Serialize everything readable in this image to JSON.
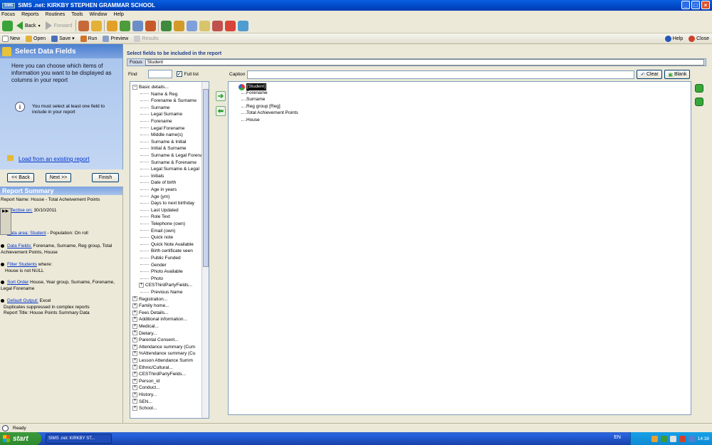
{
  "window": {
    "title": "SIMS .net: KIRKBY STEPHEN GRAMMAR SCHOOL",
    "logo": "SIMS"
  },
  "menu": [
    "Focus",
    "Reports",
    "Routines",
    "Tools",
    "Window",
    "Help"
  ],
  "nav": {
    "back": "Back",
    "forward": "Forward"
  },
  "toolbar2": {
    "new": "New",
    "open": "Open",
    "save": "Save",
    "run": "Run",
    "preview": "Preview",
    "results": "Results",
    "help": "Help",
    "close": "Close"
  },
  "left": {
    "title": "Select Data Fields",
    "intro": "Here you can choose which items of information you want to be displayed as columns in your report",
    "note": "You must select at least one field to include in your report",
    "load": "Load from an existing report",
    "back": "<< Back",
    "next": "Next >>",
    "finish": "Finish"
  },
  "summary": {
    "title": "Report Summary",
    "name": "Report Name: House - Total Acheivement Points",
    "effective_label": "Effective on:",
    "effective_value": "30/10/2011",
    "data_area_label": "Data area: Student",
    "data_area_rest": " - Population: On roll",
    "fields_label": "Data Fields:",
    "fields_value": "Forename, Surname, Reg group, Total Achievement Points, House",
    "filter_label": "Filter Students",
    "filter_rest": " where:",
    "filter_value": "House is not NULL",
    "sort_label": "Sort Order",
    "sort_value": "House, Year group, Surname, Forename, Legal Forename",
    "output_label": "Default Output:",
    "output_value": "Excel",
    "dup": "Duplicates suppressed in complex reports",
    "report_title": "Report Title: House Points Summary Data"
  },
  "main": {
    "header": "Select fields to be included in the report",
    "focus_label": "Focus",
    "focus_value": "Student",
    "find_label": "Find",
    "full_list": "Full list",
    "caption_label": "Caption",
    "clear": "Clear",
    "blank": "Blank"
  },
  "tree": {
    "root": "Basic details...",
    "children": [
      "Name & Reg",
      "Forename & Surname",
      "Surname",
      "Legal Surname",
      "Forename",
      "Legal Forename",
      "Middle name(s)",
      "Surname & Initial",
      "Initial & Surname",
      "Surname & Legal Forename",
      "Surname & Forename",
      "Legal Surname & Legal",
      "Initials",
      "Date of birth",
      "Age in years",
      "Age (ym)",
      "Days to next birthday",
      "Last Updated",
      "Role Text",
      "Telephone (own)",
      "Email (own)",
      "Quick note",
      "Quick Note Available",
      "Birth certificate seen",
      "Public Funded",
      "Gender",
      "Photo Available",
      "Photo",
      "CESThirdPartyFields...",
      "Previous Name"
    ],
    "groups": [
      "Registration...",
      "Family home...",
      "Fees Details...",
      "Additional information...",
      "Medical...",
      "Dietary...",
      "Parental Consent...",
      "Attendance summary (Cum",
      "%Attendance summary (Cu",
      "Lesson Attendance Summ",
      "Ethnic/Cultural...",
      "CESThirdPartyFields...",
      "Person_id",
      "Conduct...",
      "History...",
      "SEN...",
      "School..."
    ]
  },
  "selected": {
    "root": "[Student]",
    "fields": [
      "Forename",
      "Surname",
      "Reg group [Reg]",
      "Total Achievement Points",
      "House"
    ]
  },
  "status": "Ready",
  "taskbar": {
    "start": "start",
    "item": "SIMS .net: KIRKBY ST...",
    "lang": "EN",
    "time": "14:38"
  }
}
